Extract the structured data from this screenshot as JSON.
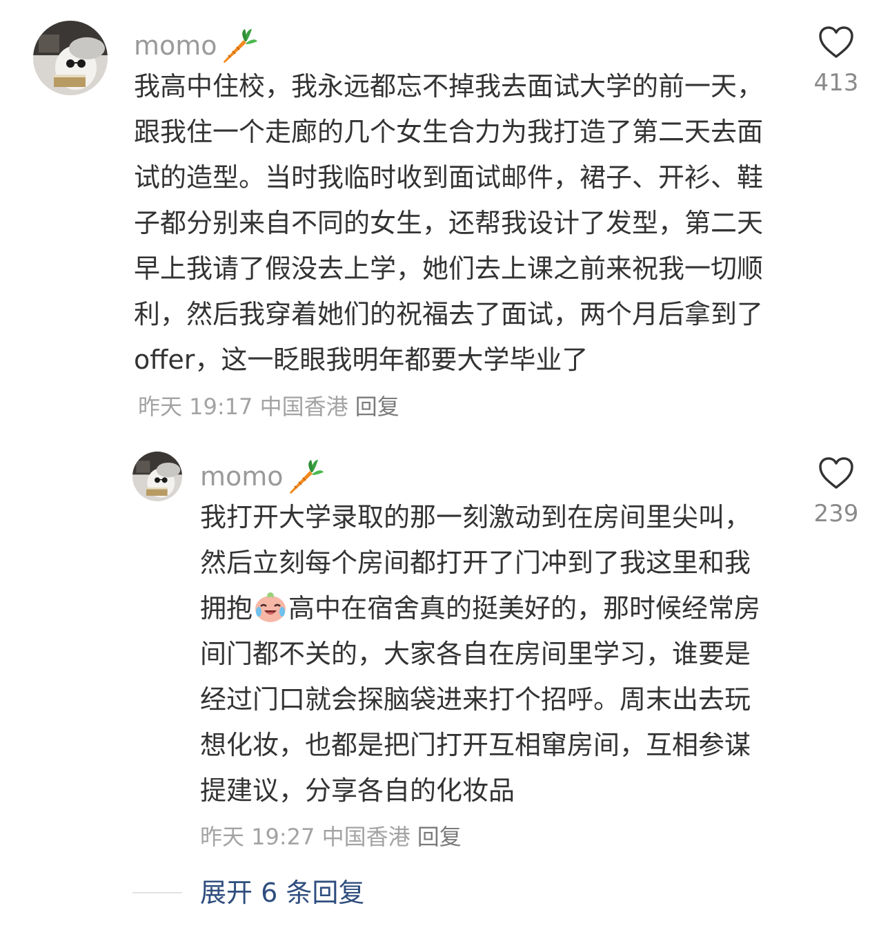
{
  "comments": [
    {
      "username": "momo",
      "username_icon": "carrot-icon",
      "text": "我高中住校，我永远都忘不掉我去面试大学的前一天，跟我住一个走廊的几个女生合力为我打造了第二天去面试的造型。当时我临时收到面试邮件，裙子、开衫、鞋子都分别来自不同的女生，还帮我设计了发型，第二天早上我请了假没去上学，她们去上课之前来祝我一切顺利，然后我穿着她们的祝福去了面试，两个月后拿到了offer，这一眨眼我明年都要大学毕业了",
      "time": "昨天 19:17",
      "location": "中国香港",
      "reply_label": "回复",
      "like_icon": "heart-outline-icon",
      "likes": "413"
    }
  ],
  "replies": [
    {
      "username": "momo",
      "username_icon": "carrot-icon",
      "text_before_emoji": "我打开大学录取的那一刻激动到在房间里尖叫，然后立刻每个房间都打开了门冲到了我这里和我拥抱",
      "emoji": "crying-laughing-sticker-icon",
      "text_after_emoji": "高中在宿舍真的挺美好的，那时候经常房间门都不关的，大家各自在房间里学习，谁要是经过门口就会探脑袋进来打个招呼。周末出去玩想化妆，也都是把门打开互相窜房间，互相参谋提建议，分享各自的化妆品",
      "time": "昨天 19:27",
      "location": "中国香港",
      "reply_label": "回复",
      "like_icon": "heart-outline-icon",
      "likes": "239"
    }
  ],
  "expand_replies": {
    "label": "展开 6 条回复"
  },
  "colors": {
    "text": "#333333",
    "username": "#9a9a9a",
    "meta": "#a3a3a3",
    "link": "#2f4e7e"
  }
}
